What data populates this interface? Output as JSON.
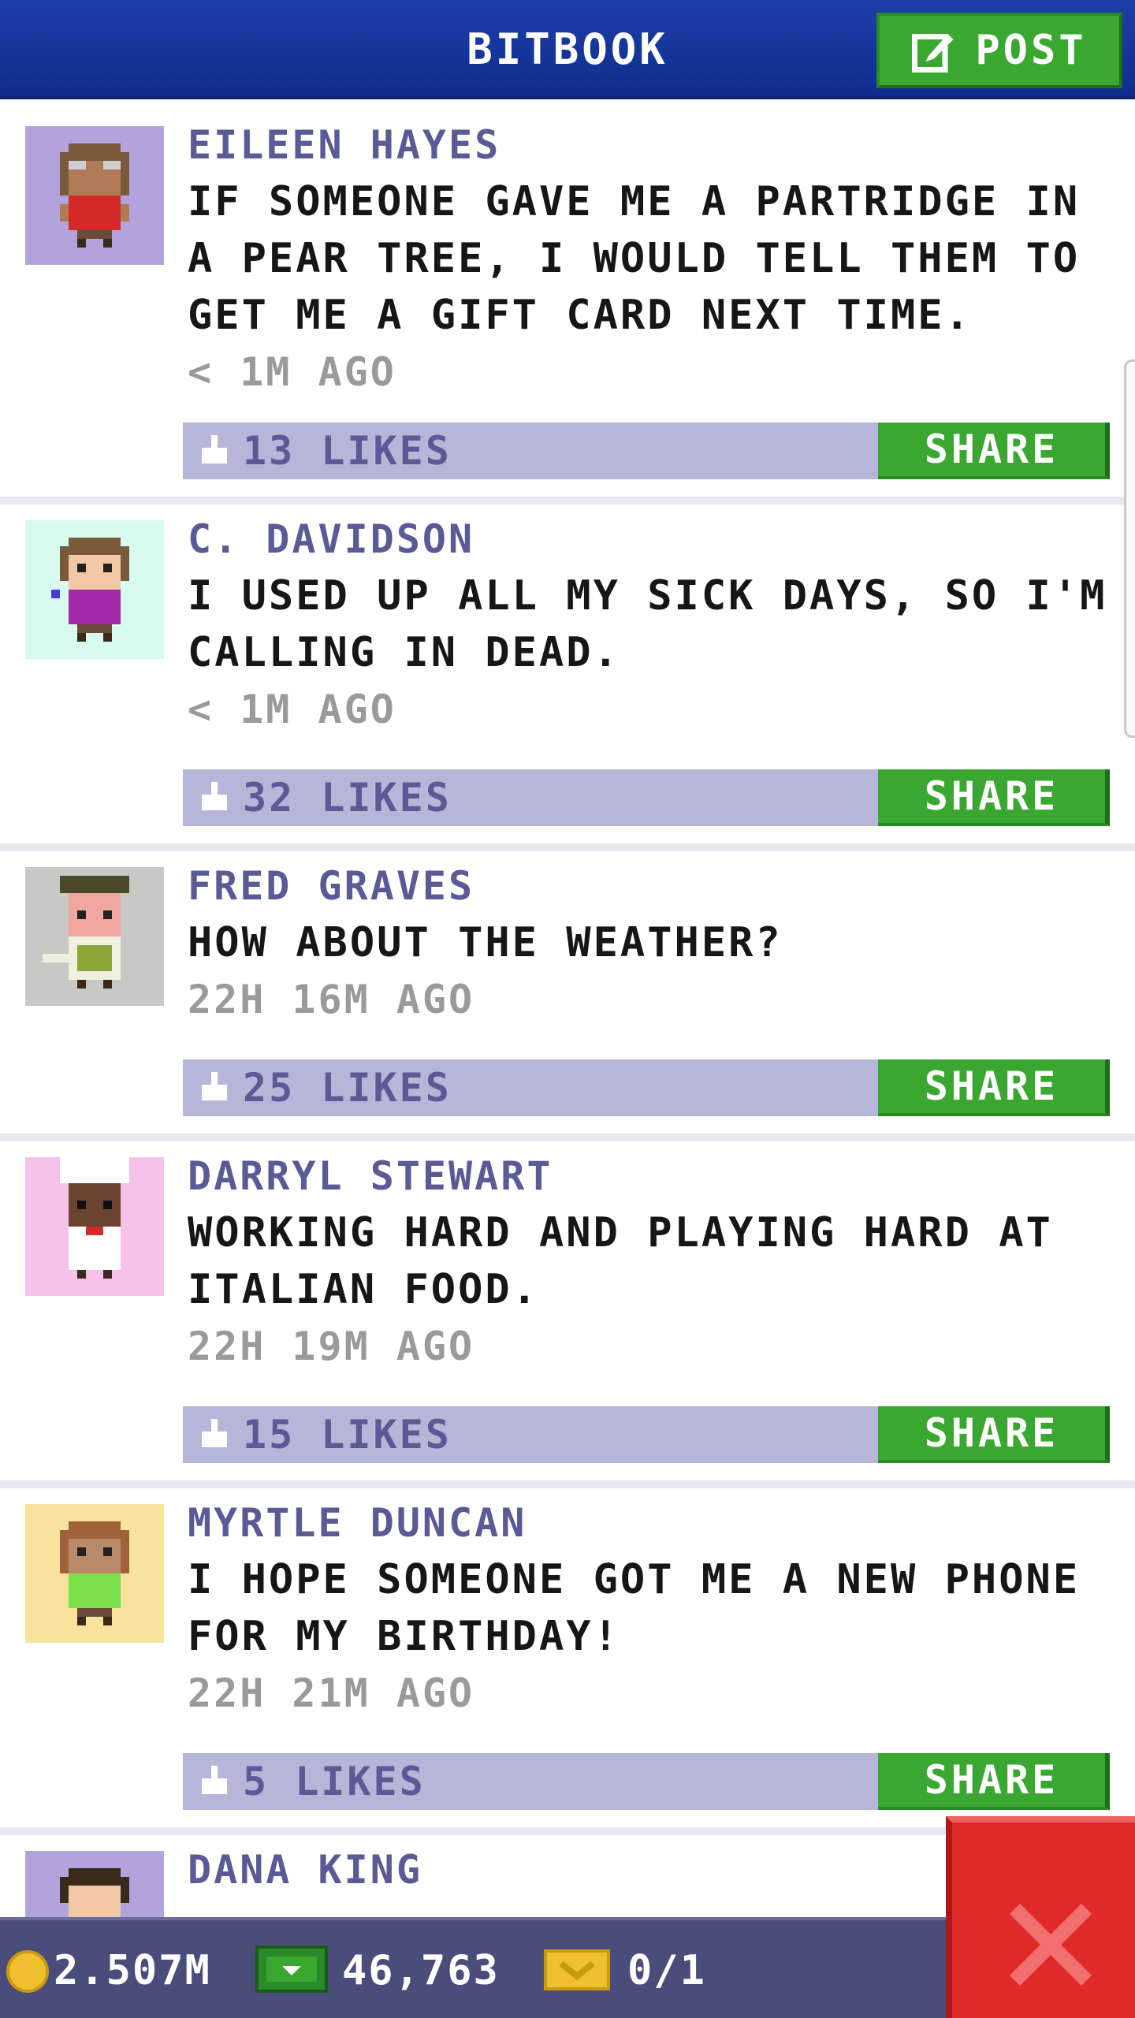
{
  "header": {
    "title": "BITBOOK",
    "post_label": "POST"
  },
  "posts": [
    {
      "author": "EILEEN HAYES",
      "text": "IF SOMEONE GAVE ME A PARTRIDGE IN A PEAR TREE, I WOULD TELL THEM TO GET ME A GIFT CARD NEXT TIME.",
      "time": "< 1M AGO",
      "likes": "13 LIKES",
      "share": "SHARE",
      "avatar_bg": "#b3a3dd"
    },
    {
      "author": "C. DAVIDSON",
      "text": "I USED UP ALL MY SICK DAYS, SO I'M CALLING IN DEAD.",
      "time": "< 1M AGO",
      "likes": "32 LIKES",
      "share": "SHARE",
      "avatar_bg": "#d8fbf0"
    },
    {
      "author": "FRED GRAVES",
      "text": "HOW ABOUT THE WEATHER?",
      "time": "22H 16M AGO",
      "likes": "25 LIKES",
      "share": "SHARE",
      "avatar_bg": "#c8c8c4"
    },
    {
      "author": "DARRYL STEWART",
      "text": "WORKING HARD AND PLAYING HARD AT ITALIAN FOOD.",
      "time": "22H 19M AGO",
      "likes": "15 LIKES",
      "share": "SHARE",
      "avatar_bg": "#f7c2ea"
    },
    {
      "author": "MYRTLE DUNCAN",
      "text": "I HOPE SOMEONE GOT ME A NEW PHONE FOR MY BIRTHDAY!",
      "time": "22H 21M AGO",
      "likes": "5 LIKES",
      "share": "SHARE",
      "avatar_bg": "#f7e39c"
    },
    {
      "author": "DANA KING",
      "avatar_bg": "#b3a3dd"
    }
  ],
  "status": {
    "coins": "2.507M",
    "bux": "46,763",
    "tickets": "0/1"
  },
  "colors": {
    "header": "#1d3fa8",
    "accent_green": "#3aa830",
    "like_bar": "#b6b7d8",
    "close_red": "#e02a2a"
  }
}
